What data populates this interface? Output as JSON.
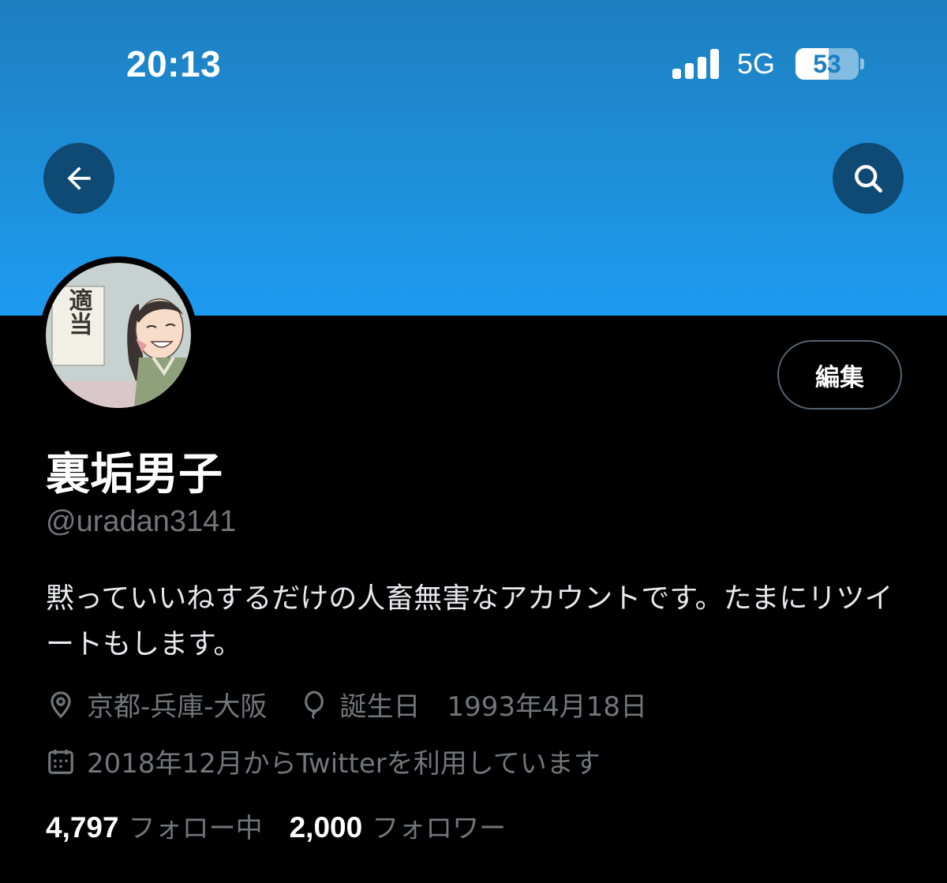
{
  "status_bar": {
    "time": "20:13",
    "network": "5G",
    "battery_level": 53,
    "battery_text": "53"
  },
  "header": {
    "back_icon": "arrow-left-icon",
    "search_icon": "search-icon"
  },
  "profile": {
    "edit_label": "編集",
    "display_name": "裏垢男子",
    "handle": "@uradan3141",
    "bio": "黙っていいねするだけの人畜無害なアカウントです。たまにリツイートもします。",
    "location": "京都-兵庫-大阪",
    "birthday": "誕生日　1993年4月18日",
    "joined": "2018年12月からTwitterを利用しています",
    "avatar_sign_text": "適当",
    "following_count": "4,797",
    "following_label": "フォロー中",
    "followers_count": "2,000",
    "followers_label": "フォロワー"
  },
  "colors": {
    "banner_top": "#1d7fc0",
    "banner_bottom": "#1d9bf0",
    "background": "#000000",
    "muted_text": "#71767b",
    "round_button": "#0f4a75"
  }
}
